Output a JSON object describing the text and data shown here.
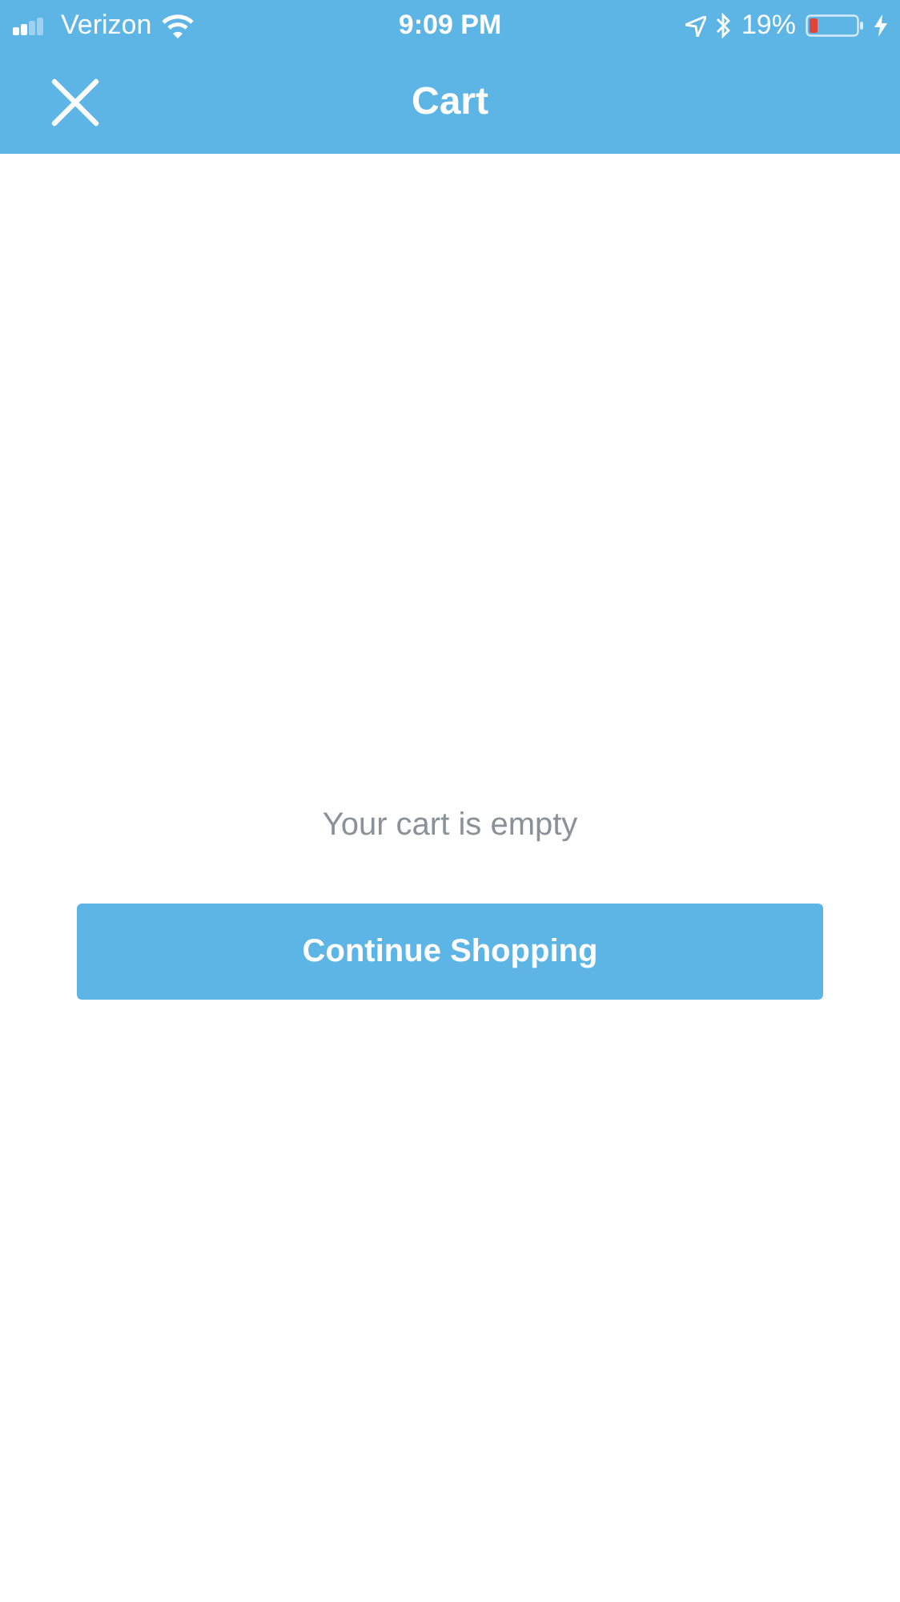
{
  "status_bar": {
    "carrier": "Verizon",
    "time": "9:09 PM",
    "battery": "19%"
  },
  "nav": {
    "title": "Cart"
  },
  "empty_message": "Your cart is empty",
  "button": {
    "label": "Continue Shopping"
  }
}
